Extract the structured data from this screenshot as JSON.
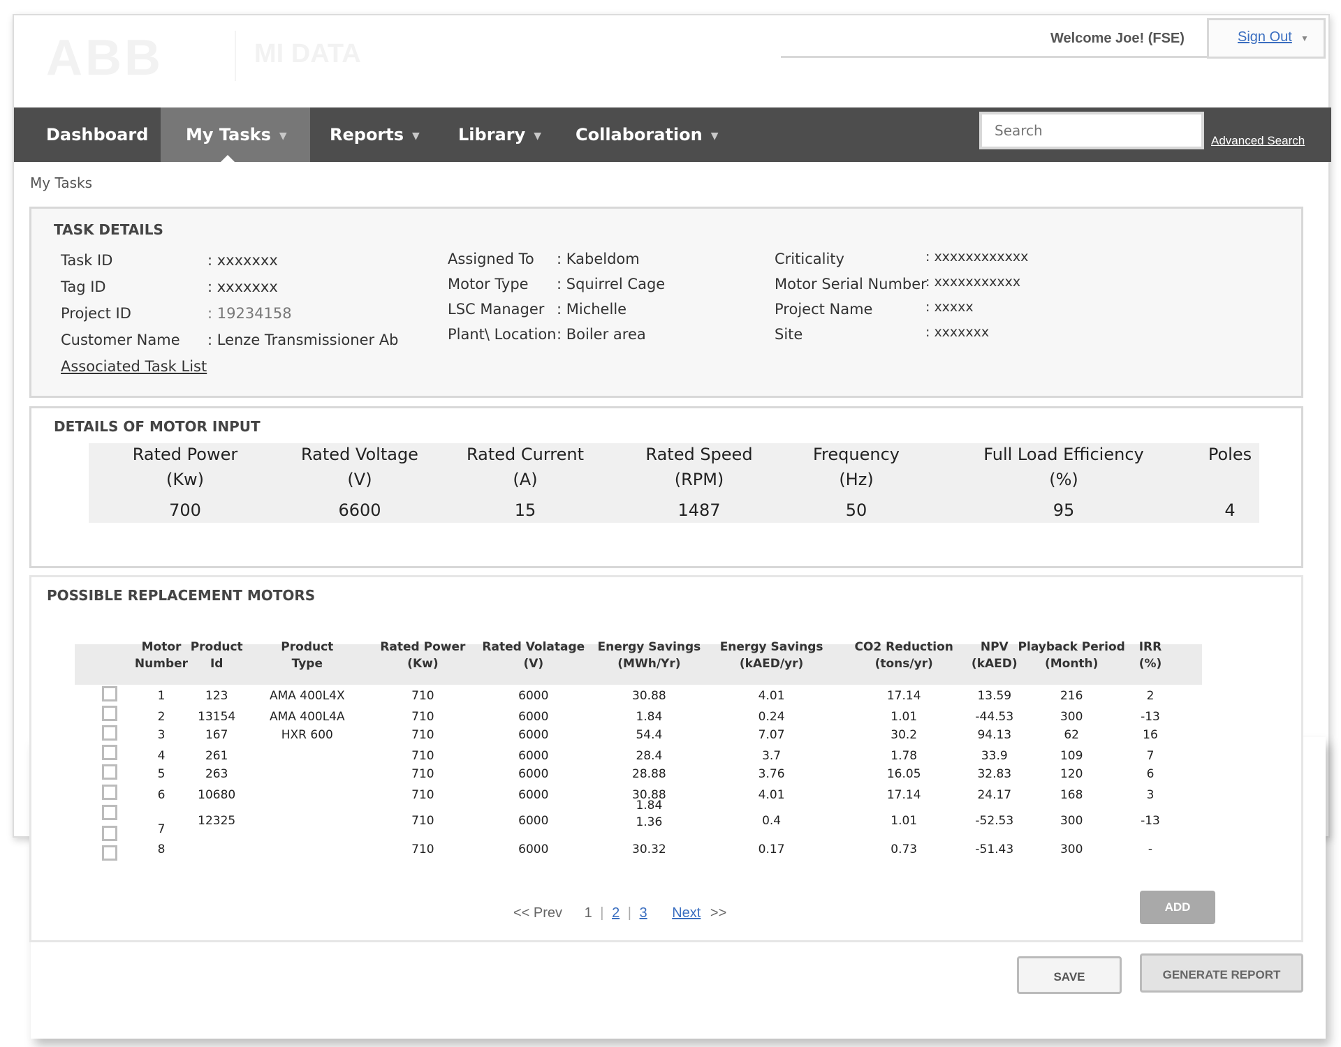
{
  "header": {
    "logo": "ABB",
    "app_name": "MI DATA",
    "welcome": "Welcome Joe!",
    "role": "(FSE)",
    "sign_out": "Sign Out"
  },
  "nav": {
    "items": [
      {
        "label": "Dashboard"
      },
      {
        "label": "My Tasks"
      },
      {
        "label": "Reports"
      },
      {
        "label": "Library"
      },
      {
        "label": "Collaboration"
      }
    ],
    "active": "My Tasks",
    "search_placeholder": "Search",
    "advanced_search": "Advanced Search"
  },
  "breadcrumb": "My Tasks",
  "task_details": {
    "title": "TASK DETAILS",
    "col1": [
      {
        "label": "Task ID",
        "value": ": xxxxxxx"
      },
      {
        "label": "Tag ID",
        "value": ": xxxxxxx"
      },
      {
        "label": "Project ID",
        "value": ": 19234158"
      },
      {
        "label": "Customer Name",
        "value": ": Lenze Transmissioner Ab"
      }
    ],
    "associated_link": "Associated Task List",
    "col2": [
      {
        "label": "Assigned To",
        "value": ": Kabeldom"
      },
      {
        "label": "Motor Type",
        "value": ": Squirrel Cage"
      },
      {
        "label": "LSC Manager",
        "value": ": Michelle"
      },
      {
        "label": "Plant\\ Location",
        "value": ": Boiler area"
      }
    ],
    "col3": [
      {
        "label": "Criticality",
        "value": ": xxxxxxxxxxxx"
      },
      {
        "label": "Motor Serial Number",
        "value": ": xxxxxxxxxxx"
      },
      {
        "label": "Project Name",
        "value": ": xxxxx"
      },
      {
        "label": "Site",
        "value": ": xxxxxxx"
      }
    ]
  },
  "motor_input": {
    "title": "DETAILS OF MOTOR INPUT",
    "columns": [
      {
        "h1": "Rated Power",
        "h2": "(Kw)",
        "value": "700"
      },
      {
        "h1": "Rated Voltage",
        "h2": "(V)",
        "value": "6600"
      },
      {
        "h1": "Rated Current",
        "h2": "(A)",
        "value": "15"
      },
      {
        "h1": "Rated Speed",
        "h2": "(RPM)",
        "value": "1487"
      },
      {
        "h1": "Frequency",
        "h2": "(Hz)",
        "value": "50"
      },
      {
        "h1": "Full Load Efficiency",
        "h2": "(%)",
        "value": "95"
      },
      {
        "h1": "Poles",
        "h2": "",
        "value": "4"
      }
    ]
  },
  "replacement": {
    "title": "POSSIBLE REPLACEMENT MOTORS",
    "headers": [
      {
        "h1": "Motor",
        "h2": "Number"
      },
      {
        "h1": "Product",
        "h2": "Id"
      },
      {
        "h1": "Product",
        "h2": "Type"
      },
      {
        "h1": "Rated Power",
        "h2": "(Kw)"
      },
      {
        "h1": "Rated Volatage",
        "h2": "(V)"
      },
      {
        "h1": "Energy Savings",
        "h2": "(MWh/Yr)"
      },
      {
        "h1": "Energy Savings",
        "h2": "(kAED/yr)"
      },
      {
        "h1": "CO2 Reduction",
        "h2": "(tons/yr)"
      },
      {
        "h1": "NPV",
        "h2": "(kAED)"
      },
      {
        "h1": "Playback Period",
        "h2": "(Month)"
      },
      {
        "h1": "IRR",
        "h2": "(%)"
      }
    ],
    "rows": [
      [
        "1",
        "123",
        "AMA 400L4X",
        "710",
        "6000",
        "30.88",
        "4.01",
        "17.14",
        "13.59",
        "216",
        "2"
      ],
      [
        "2",
        "13154",
        "AMA 400L4A",
        "710",
        "6000",
        "1.84",
        "0.24",
        "1.01",
        "-44.53",
        "300",
        "-13"
      ],
      [
        "3",
        "167",
        "HXR 600",
        "710",
        "6000",
        "54.4",
        "7.07",
        "30.2",
        "94.13",
        "62",
        "16"
      ],
      [
        "4",
        "261",
        "",
        "710",
        "6000",
        "28.4",
        "3.7",
        "1.78",
        "33.9",
        "109",
        "7"
      ],
      [
        "5",
        "263",
        "",
        "710",
        "6000",
        "28.88",
        "3.76",
        "16.05",
        "32.83",
        "120",
        "6"
      ],
      [
        "6",
        "10680",
        "",
        "710",
        "6000",
        "30.88",
        "4.01",
        "17.14",
        "24.17",
        "168",
        "3"
      ],
      [
        "7",
        "12325",
        "",
        "710",
        "6000",
        "1.84\n1.36",
        "0.4",
        "1.01",
        "-52.53",
        "300",
        "-13"
      ],
      [
        "8",
        "",
        "",
        "710",
        "6000",
        "30.32",
        "0.17",
        "0.73",
        "-51.43",
        "300",
        "-"
      ]
    ],
    "checkbox_count": 9,
    "pager": {
      "prev": "<< Prev",
      "pages": [
        "1",
        "2",
        "3"
      ],
      "next": "Next",
      "next_arrows": ">>"
    },
    "add_button": "ADD"
  },
  "footer_buttons": {
    "save": "SAVE",
    "generate": "GENERATE REPORT"
  }
}
